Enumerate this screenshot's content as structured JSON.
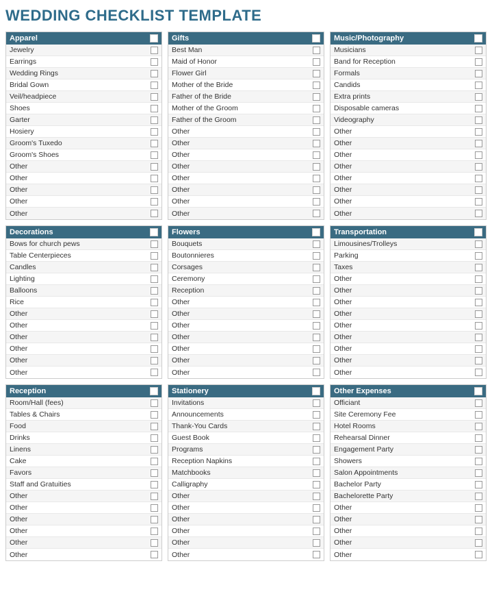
{
  "title": "WEDDING CHECKLIST TEMPLATE",
  "sections": [
    {
      "id": "apparel",
      "label": "Apparel",
      "items": [
        "Jewelry",
        "Earrings",
        "Wedding Rings",
        "Bridal Gown",
        "Veil/headpiece",
        "Shoes",
        "Garter",
        "Hosiery",
        "Groom's Tuxedo",
        "Groom's Shoes",
        "Other",
        "Other",
        "Other",
        "Other",
        "Other"
      ]
    },
    {
      "id": "gifts",
      "label": "Gifts",
      "items": [
        "Best Man",
        "Maid of Honor",
        "Flower Girl",
        "Mother of the Bride",
        "Father of the Bride",
        "Mother of the Groom",
        "Father of the Groom",
        "Other",
        "Other",
        "Other",
        "Other",
        "Other",
        "Other",
        "Other",
        "Other"
      ]
    },
    {
      "id": "music-photography",
      "label": "Music/Photography",
      "items": [
        "Musicians",
        "Band for Reception",
        "Formals",
        "Candids",
        "Extra prints",
        "Disposable cameras",
        "Videography",
        "Other",
        "Other",
        "Other",
        "Other",
        "Other",
        "Other",
        "Other",
        "Other"
      ]
    },
    {
      "id": "decorations",
      "label": "Decorations",
      "items": [
        "Bows for church pews",
        "Table Centerpieces",
        "Candles",
        "Lighting",
        "Balloons",
        "Rice",
        "Other",
        "Other",
        "Other",
        "Other",
        "Other",
        "Other"
      ]
    },
    {
      "id": "flowers",
      "label": "Flowers",
      "items": [
        "Bouquets",
        "Boutonnieres",
        "Corsages",
        "Ceremony",
        "Reception",
        "Other",
        "Other",
        "Other",
        "Other",
        "Other",
        "Other",
        "Other"
      ]
    },
    {
      "id": "transportation",
      "label": "Transportation",
      "items": [
        "Limousines/Trolleys",
        "Parking",
        "Taxes",
        "Other",
        "Other",
        "Other",
        "Other",
        "Other",
        "Other",
        "Other",
        "Other",
        "Other"
      ]
    },
    {
      "id": "reception",
      "label": "Reception",
      "items": [
        "Room/Hall (fees)",
        "Tables & Chairs",
        "Food",
        "Drinks",
        "Linens",
        "Cake",
        "Favors",
        "Staff and Gratuities",
        "Other",
        "Other",
        "Other",
        "Other",
        "Other",
        "Other"
      ]
    },
    {
      "id": "stationery",
      "label": "Stationery",
      "items": [
        "Invitations",
        "Announcements",
        "Thank-You Cards",
        "Guest Book",
        "Programs",
        "Reception Napkins",
        "Matchbooks",
        "Calligraphy",
        "Other",
        "Other",
        "Other",
        "Other",
        "Other",
        "Other"
      ]
    },
    {
      "id": "other-expenses",
      "label": "Other Expenses",
      "items": [
        "Officiant",
        "Site Ceremony Fee",
        "Hotel Rooms",
        "Rehearsal Dinner",
        "Engagement Party",
        "Showers",
        "Salon Appointments",
        "Bachelor Party",
        "Bachelorette Party",
        "Other",
        "Other",
        "Other",
        "Other",
        "Other"
      ]
    }
  ]
}
